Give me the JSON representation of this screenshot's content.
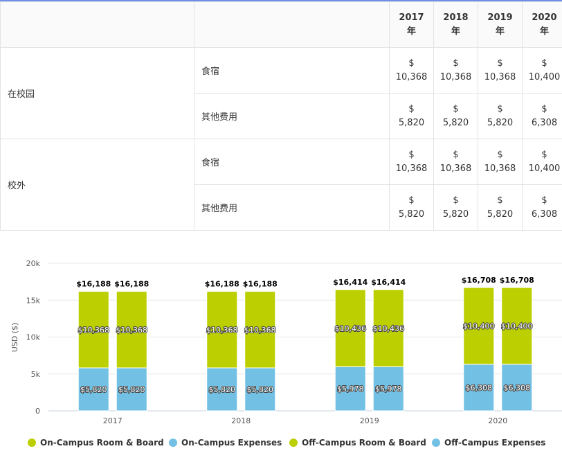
{
  "table": {
    "columns": [
      {
        "year": "2017",
        "suffix": "年"
      },
      {
        "year": "2018",
        "suffix": "年"
      },
      {
        "year": "2019",
        "suffix": "年"
      },
      {
        "year": "2020",
        "suffix": "年"
      }
    ],
    "groups": [
      {
        "label": "在校园",
        "rows": [
          {
            "label": "食宿",
            "values": [
              [
                "$",
                "10,368"
              ],
              [
                "$",
                "10,368"
              ],
              [
                "$",
                "10,368"
              ],
              [
                "$",
                "10,400"
              ]
            ]
          },
          {
            "label": "其他费用",
            "values": [
              [
                "$",
                "5,820"
              ],
              [
                "$",
                "5,820"
              ],
              [
                "$",
                "5,820"
              ],
              [
                "$",
                "6,308"
              ]
            ]
          }
        ]
      },
      {
        "label": "校外",
        "rows": [
          {
            "label": "食宿",
            "values": [
              [
                "$",
                "10,368"
              ],
              [
                "$",
                "10,368"
              ],
              [
                "$",
                "10,368"
              ],
              [
                "$",
                "10,400"
              ]
            ]
          },
          {
            "label": "其他费用",
            "values": [
              [
                "$",
                "5,820"
              ],
              [
                "$",
                "5,820"
              ],
              [
                "$",
                "5,820"
              ],
              [
                "$",
                "6,308"
              ]
            ]
          }
        ]
      }
    ]
  },
  "chart_data": {
    "type": "bar",
    "stacked": true,
    "categories": [
      "2017",
      "2018",
      "2019",
      "2020"
    ],
    "ylabel": "USD ($)",
    "ylim": [
      0,
      20000
    ],
    "yticks": [
      0,
      5000,
      10000,
      15000,
      20000
    ],
    "ytick_labels": [
      "0",
      "5k",
      "10k",
      "15k",
      "20k"
    ],
    "grid": true,
    "legend_position": "bottom",
    "colors": {
      "room_board": "#bccf00",
      "expenses": "#72c1e4"
    },
    "stacks": [
      {
        "segments": [
          {
            "name": "On-Campus Expenses",
            "values": [
              5820,
              5820,
              5978,
              6308
            ],
            "labels": [
              "$5,820",
              "$5,820",
              "$5,978",
              "$6,308"
            ],
            "color": "#72c1e4"
          },
          {
            "name": "On-Campus Room & Board",
            "values": [
              10368,
              10368,
              10436,
              10400
            ],
            "labels": [
              "$10,368",
              "$10,368",
              "$10,436",
              "$10,400"
            ],
            "color": "#bccf00"
          }
        ],
        "totals": [
          "$16,188",
          "$16,188",
          "$16,414",
          "$16,708"
        ]
      },
      {
        "segments": [
          {
            "name": "Off-Campus Expenses",
            "values": [
              5820,
              5820,
              5978,
              6308
            ],
            "labels": [
              "$5,820",
              "$5,820",
              "$5,978",
              "$6,308"
            ],
            "color": "#72c1e4"
          },
          {
            "name": "Off-Campus Room & Board",
            "values": [
              10368,
              10368,
              10436,
              10400
            ],
            "labels": [
              "$10,368",
              "$10,368",
              "$10,436",
              "$10,400"
            ],
            "color": "#bccf00"
          }
        ],
        "totals": [
          "$16,188",
          "$16,188",
          "$16,414",
          "$16,708"
        ]
      }
    ],
    "legend": [
      {
        "label": "On-Campus Room & Board",
        "color": "#bccf00"
      },
      {
        "label": "On-Campus Expenses",
        "color": "#72c1e4"
      },
      {
        "label": "Off-Campus Room & Board",
        "color": "#bccf00"
      },
      {
        "label": "Off-Campus Expenses",
        "color": "#72c1e4"
      }
    ]
  }
}
